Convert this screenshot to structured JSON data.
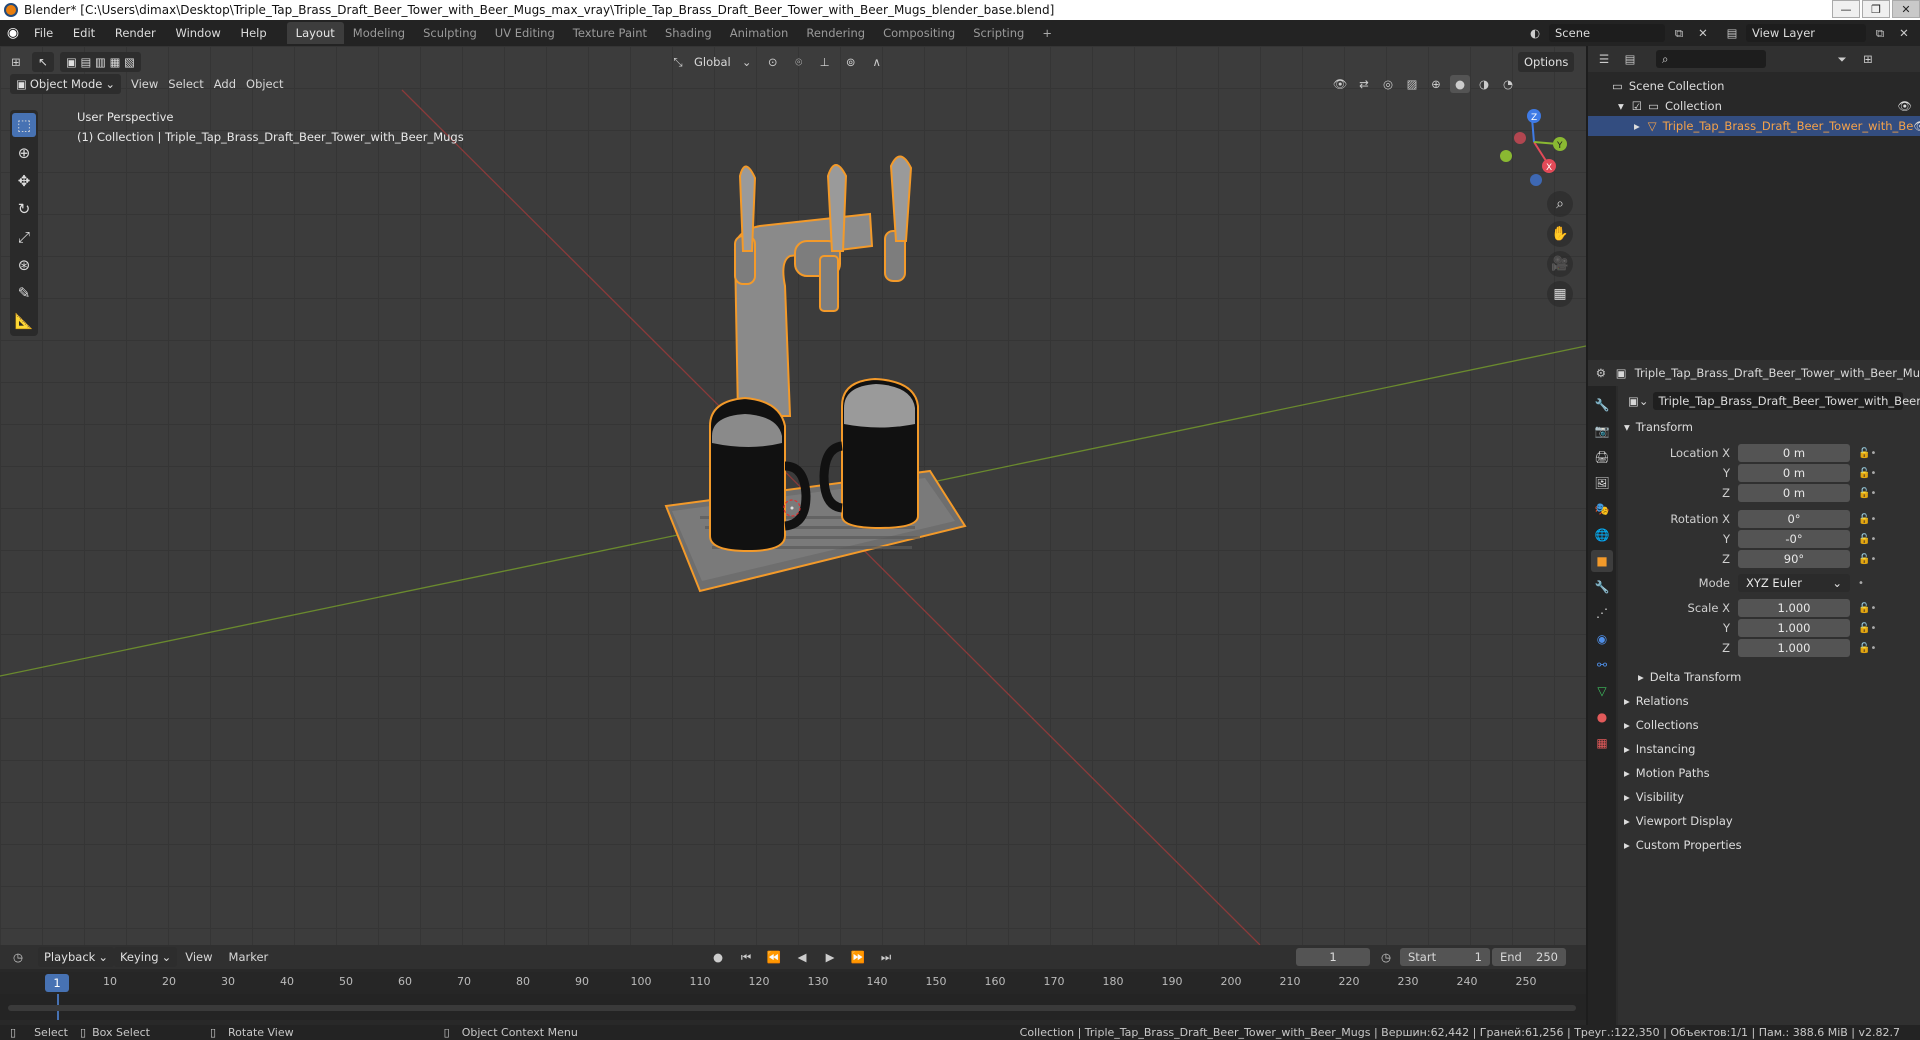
{
  "window": {
    "title": "Blender* [C:\\Users\\dimax\\Desktop\\Triple_Tap_Brass_Draft_Beer_Tower_with_Beer_Mugs_max_vray\\Triple_Tap_Brass_Draft_Beer_Tower_with_Beer_Mugs_blender_base.blend]",
    "controls": [
      "—",
      "❐",
      "✕"
    ]
  },
  "menu": [
    "File",
    "Edit",
    "Render",
    "Window",
    "Help"
  ],
  "workspaces": [
    "Layout",
    "Modeling",
    "Sculpting",
    "UV Editing",
    "Texture Paint",
    "Shading",
    "Animation",
    "Rendering",
    "Compositing",
    "Scripting"
  ],
  "workspace_active": "Layout",
  "scene": {
    "label": "Scene",
    "view_layer": "View Layer"
  },
  "viewport_header": {
    "mode": "Object Mode",
    "menus": [
      "View",
      "Select",
      "Add",
      "Object"
    ],
    "orientation": "Global",
    "options": "Options"
  },
  "viewport": {
    "perspective": "User Perspective",
    "collection_info": "(1) Collection | Triple_Tap_Brass_Draft_Beer_Tower_with_Beer_Mugs",
    "gizmo": {
      "x": "X",
      "y": "Y",
      "z": "Z"
    }
  },
  "tools": [
    "select-box",
    "cursor",
    "move",
    "rotate",
    "scale",
    "transform",
    "annotate",
    "measure"
  ],
  "outliner": {
    "scene_collection": "Scene Collection",
    "collection": "Collection",
    "object": "Triple_Tap_Brass_Draft_Beer_Tower_with_Be"
  },
  "properties": {
    "object_name": "Triple_Tap_Brass_Draft_Beer_Tower_with_Beer_Mu",
    "object_field": "Triple_Tap_Brass_Draft_Beer_Tower_with_Beer_...",
    "transform_title": "Transform",
    "location_label": "Location X",
    "rotation_label": "Rotation X",
    "scale_label": "Scale X",
    "y_label": "Y",
    "z_label": "Z",
    "mode_label": "Mode",
    "location": [
      "0 m",
      "0 m",
      "0 m"
    ],
    "rotation": [
      "0°",
      "-0°",
      "90°"
    ],
    "mode": "XYZ Euler",
    "scale": [
      "1.000",
      "1.000",
      "1.000"
    ],
    "delta": "Delta Transform",
    "sections": [
      "Relations",
      "Collections",
      "Instancing",
      "Motion Paths",
      "Visibility",
      "Viewport Display",
      "Custom Properties"
    ]
  },
  "timeline": {
    "menus": [
      "Playback",
      "Keying",
      "View",
      "Marker"
    ],
    "current_frame": "1",
    "start_label": "Start",
    "start": "1",
    "end_label": "End",
    "end": "250",
    "ticks": [
      "10",
      "20",
      "30",
      "40",
      "50",
      "60",
      "70",
      "80",
      "90",
      "100",
      "110",
      "120",
      "130",
      "140",
      "150",
      "160",
      "170",
      "180",
      "190",
      "200",
      "210",
      "220",
      "230",
      "240",
      "250"
    ],
    "ruler_frame": "1"
  },
  "statusbar": {
    "select": "Select",
    "box_select": "Box Select",
    "rotate_view": "Rotate View",
    "context_menu": "Object Context Menu",
    "stats": "Collection | Triple_Tap_Brass_Draft_Beer_Tower_with_Beer_Mugs | Вершин:62,442 | Граней:61,256 | Треуг.:122,350 | Объектов:1/1 | Пам.: 388.6 MiB | v2.82.7"
  }
}
